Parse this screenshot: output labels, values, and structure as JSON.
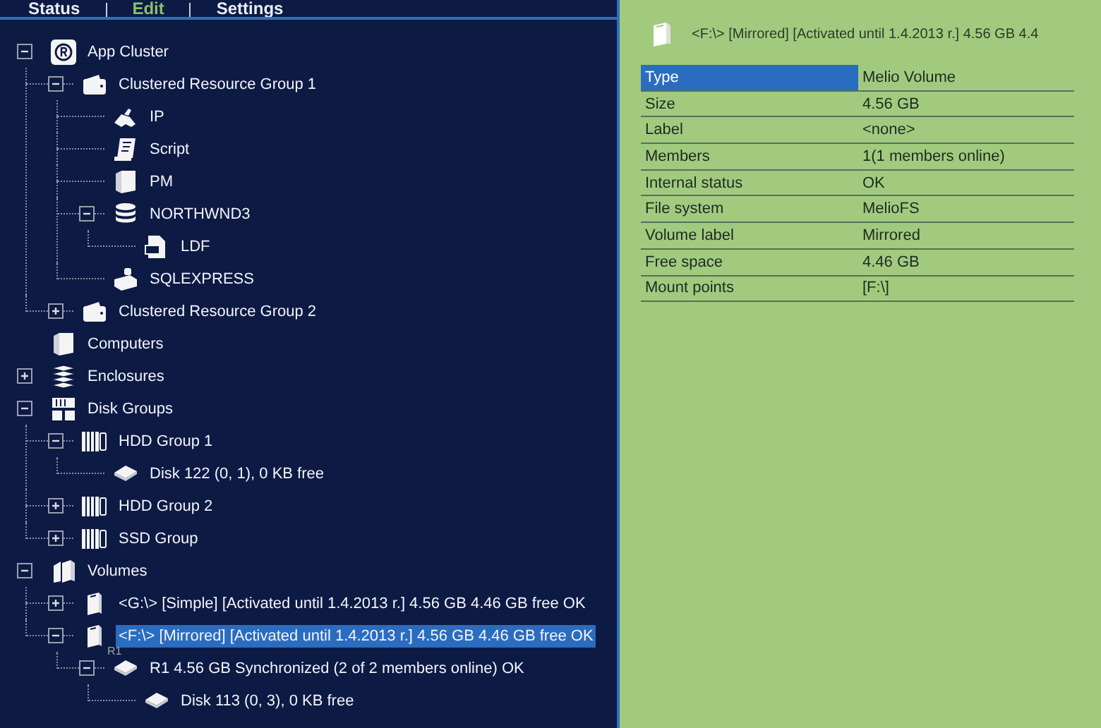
{
  "tabs": [
    {
      "label": "Status",
      "selected": false
    },
    {
      "label": "Edit",
      "selected": true
    },
    {
      "label": "Settings",
      "selected": false
    }
  ],
  "tree": [
    {
      "label": "App Cluster",
      "kind": "cluster",
      "expanded": true,
      "selected": false,
      "children": [
        {
          "label": "Clustered Resource Group 1",
          "kind": "group",
          "expanded": true,
          "selected": false,
          "children": [
            {
              "label": "IP",
              "kind": "ip",
              "selected": false
            },
            {
              "label": "Script",
              "kind": "script",
              "selected": false
            },
            {
              "label": "PM",
              "kind": "server",
              "selected": false
            },
            {
              "label": "NORTHWND3",
              "kind": "database",
              "expanded": true,
              "selected": false,
              "children": [
                {
                  "label": "LDF",
                  "kind": "file",
                  "selected": false
                }
              ]
            },
            {
              "label": "SQLEXPRESS",
              "kind": "sql",
              "selected": false
            }
          ]
        },
        {
          "label": "Clustered Resource Group 2",
          "kind": "group",
          "expanded": false,
          "selected": false
        }
      ]
    },
    {
      "label": "Computers",
      "kind": "server",
      "selected": false
    },
    {
      "label": "Enclosures",
      "kind": "enclosure",
      "expanded": false,
      "selected": false
    },
    {
      "label": "Disk Groups",
      "kind": "diskgroups",
      "expanded": true,
      "selected": false,
      "children": [
        {
          "label": "HDD Group 1",
          "kind": "hddgroup",
          "expanded": true,
          "selected": false,
          "children": [
            {
              "label": "Disk 122 (0, 1), 0 KB free",
              "kind": "disk",
              "selected": false
            }
          ]
        },
        {
          "label": "HDD Group 2",
          "kind": "hddgroup",
          "expanded": false,
          "selected": false
        },
        {
          "label": "SSD Group",
          "kind": "hddgroup",
          "expanded": false,
          "selected": false
        }
      ]
    },
    {
      "label": "Volumes",
      "kind": "volumes",
      "expanded": true,
      "selected": false,
      "children": [
        {
          "label": "<G:\\> [Simple] [Activated until 1.4.2013 r.] 4.56 GB 4.46 GB free OK",
          "kind": "volume",
          "expanded": false,
          "selected": false
        },
        {
          "label": "<F:\\> [Mirrored] [Activated until 1.4.2013 r.] 4.56 GB 4.46 GB free OK",
          "kind": "volume",
          "expanded": true,
          "selected": true,
          "children": [
            {
              "label": "R1 4.56 GB Synchronized  (2 of 2 members online) OK",
              "kind": "raid",
              "badge": "R1",
              "expanded": true,
              "selected": false,
              "children": [
                {
                  "label": "Disk 113 (0, 3), 0 KB free",
                  "kind": "disk",
                  "selected": false
                }
              ]
            }
          ]
        }
      ]
    }
  ],
  "details": {
    "title": "<F:\\> [Mirrored] [Activated until 1.4.2013 r.] 4.56 GB 4.4",
    "properties": [
      {
        "name": "Type",
        "value": "Melio Volume",
        "selected": true
      },
      {
        "name": "Size",
        "value": "4.56 GB",
        "selected": false
      },
      {
        "name": "Label",
        "value": "<none>",
        "selected": false
      },
      {
        "name": "Members",
        "value": "1(1 members online)",
        "selected": false
      },
      {
        "name": "Internal status",
        "value": "OK",
        "selected": false
      },
      {
        "name": "File system",
        "value": "MelioFS",
        "selected": false
      },
      {
        "name": "Volume label",
        "value": "Mirrored",
        "selected": false
      },
      {
        "name": "Free space",
        "value": "4.46 GB",
        "selected": false
      },
      {
        "name": "Mount points",
        "value": "[F:\\]",
        "selected": false
      }
    ]
  }
}
